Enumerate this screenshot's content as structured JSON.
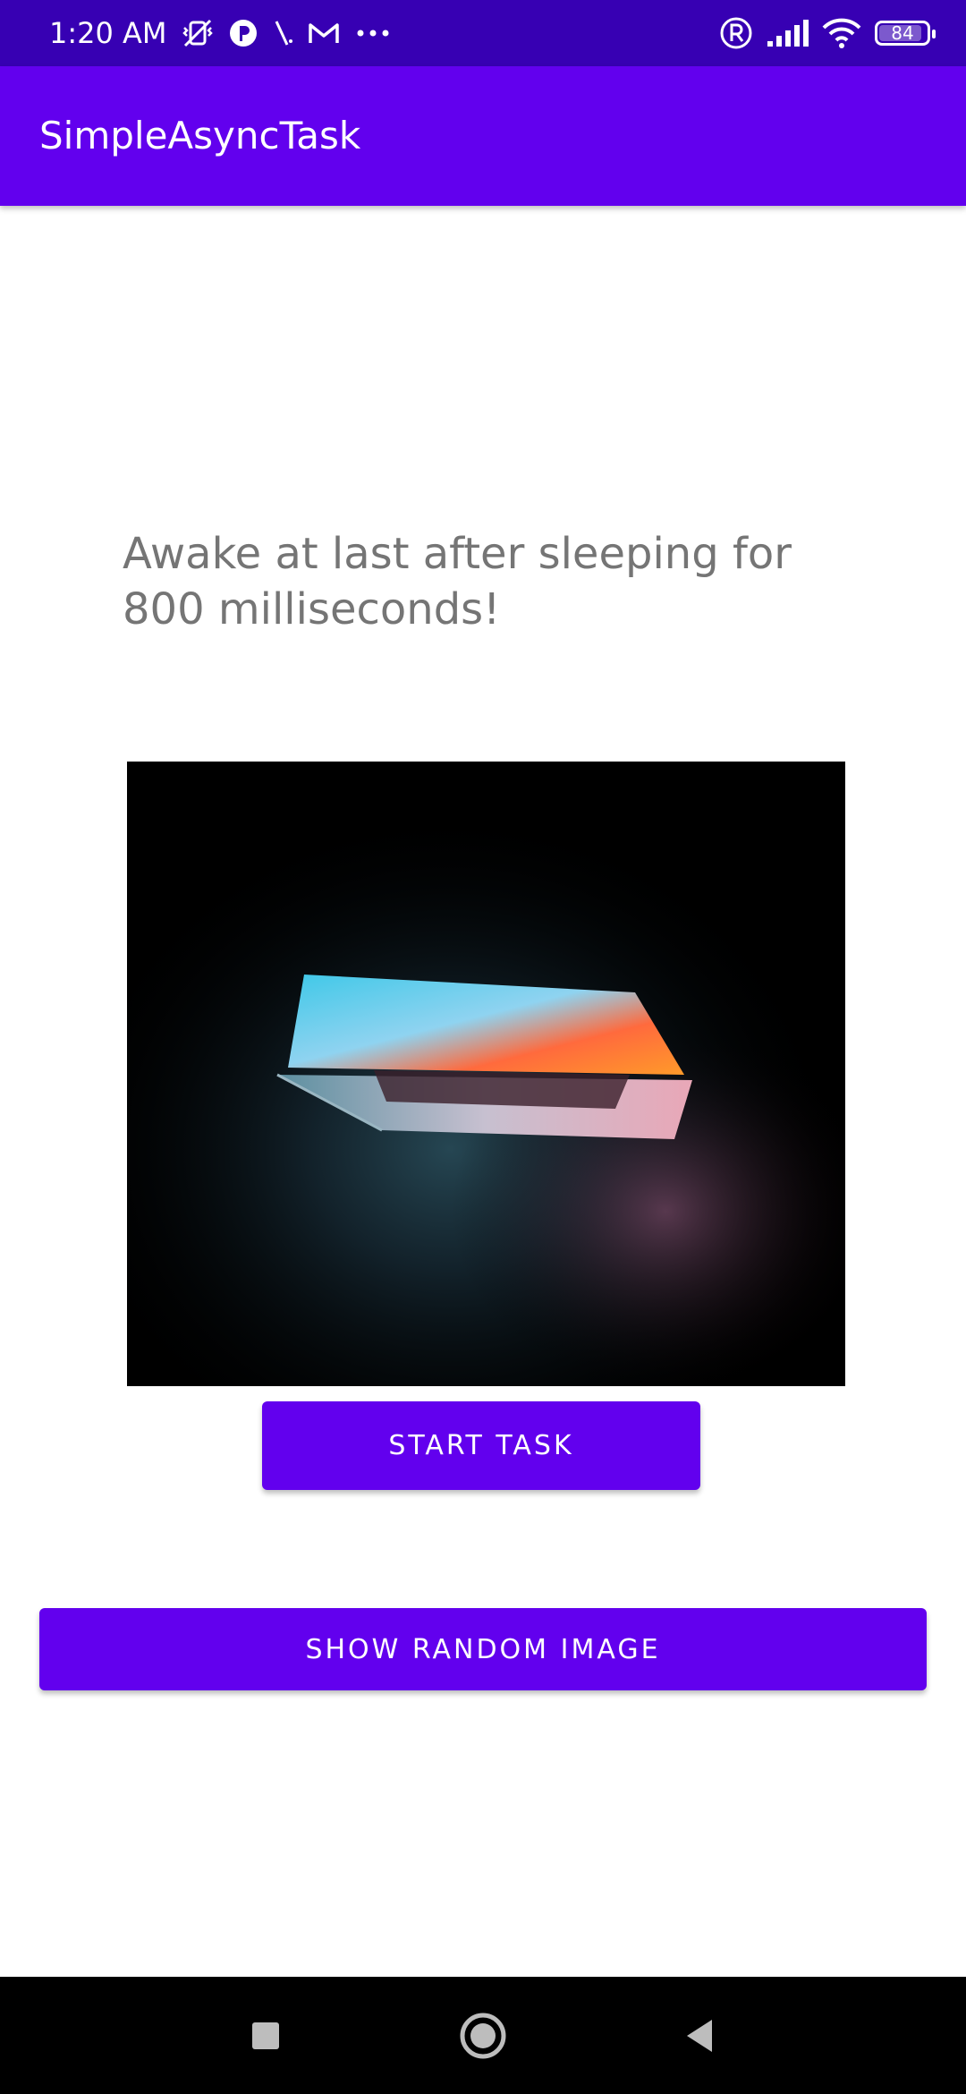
{
  "status_bar": {
    "time": "1:20 AM",
    "left_icons": [
      "vibrate-off-icon",
      "p-icon",
      "slash-icon",
      "gmail-icon",
      "more-dots-icon"
    ],
    "right_icons": [
      "registered-icon",
      "signal-icon",
      "wifi-icon"
    ],
    "battery_level": "84"
  },
  "app_bar": {
    "title": "SimpleAsyncTask"
  },
  "main": {
    "message": "Awake at last after sleeping for 800 milliseconds!",
    "image_alt": "laptop-photo",
    "start_button": "START TASK",
    "random_button": "SHOW RANDOM IMAGE"
  },
  "nav_bar": {
    "buttons": [
      "recents-icon",
      "home-icon",
      "back-icon"
    ]
  },
  "colors": {
    "status": "#3700b3",
    "primary": "#6200ee",
    "text_secondary": "#757575"
  }
}
